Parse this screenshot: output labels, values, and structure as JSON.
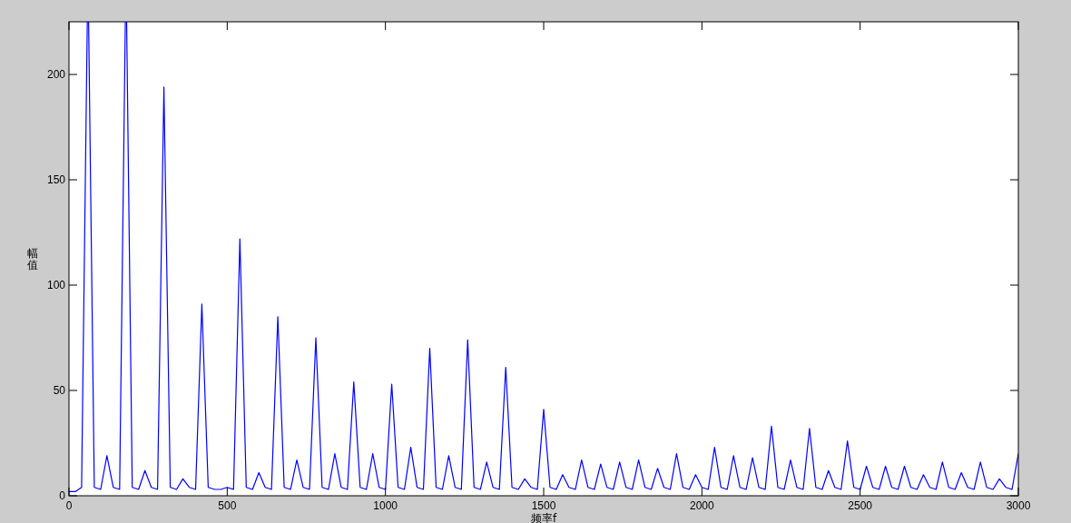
{
  "figure": {
    "chart_data": {
      "type": "line",
      "xlabel": "频率f",
      "ylabel": "幅值",
      "xlim": [
        0,
        3000
      ],
      "ylim": [
        0,
        225
      ],
      "xticks": [
        0,
        500,
        1000,
        1500,
        2000,
        2500,
        3000
      ],
      "yticks": [
        0,
        50,
        100,
        150,
        200
      ],
      "x": [
        0,
        20,
        40,
        60,
        80,
        100,
        120,
        140,
        160,
        180,
        200,
        220,
        240,
        260,
        280,
        300,
        320,
        340,
        360,
        380,
        400,
        420,
        440,
        460,
        480,
        500,
        520,
        540,
        560,
        580,
        600,
        620,
        640,
        660,
        680,
        700,
        720,
        740,
        760,
        780,
        800,
        820,
        840,
        860,
        880,
        900,
        920,
        940,
        960,
        980,
        1000,
        1020,
        1040,
        1060,
        1080,
        1100,
        1120,
        1140,
        1160,
        1180,
        1200,
        1220,
        1240,
        1260,
        1280,
        1300,
        1320,
        1340,
        1360,
        1380,
        1400,
        1420,
        1440,
        1460,
        1480,
        1500,
        1520,
        1540,
        1560,
        1580,
        1600,
        1620,
        1640,
        1660,
        1680,
        1700,
        1720,
        1740,
        1760,
        1780,
        1800,
        1820,
        1840,
        1860,
        1880,
        1900,
        1920,
        1940,
        1960,
        1980,
        2000,
        2020,
        2040,
        2060,
        2080,
        2100,
        2120,
        2140,
        2160,
        2180,
        2200,
        2220,
        2240,
        2260,
        2280,
        2300,
        2320,
        2340,
        2360,
        2380,
        2400,
        2420,
        2440,
        2460,
        2480,
        2500,
        2520,
        2540,
        2560,
        2580,
        2600,
        2620,
        2640,
        2660,
        2680,
        2700,
        2720,
        2740,
        2760,
        2780,
        2800,
        2820,
        2840,
        2860,
        2880,
        2900,
        2920,
        2940,
        2960,
        2980,
        3000
      ],
      "series": [
        {
          "color": "#0000ff",
          "values": [
            2,
            2,
            4,
            null,
            4,
            3,
            19,
            4,
            3,
            null,
            4,
            3,
            12,
            4,
            3,
            194,
            4,
            3,
            8,
            4,
            3,
            91,
            4,
            3,
            3,
            4,
            3,
            122,
            4,
            3,
            11,
            4,
            3,
            85,
            4,
            3,
            17,
            4,
            3,
            75,
            4,
            3,
            20,
            4,
            3,
            54,
            4,
            3,
            20,
            4,
            3,
            53,
            4,
            3,
            23,
            4,
            3,
            70,
            4,
            3,
            19,
            4,
            3,
            74,
            4,
            3,
            16,
            4,
            3,
            61,
            4,
            3,
            8,
            4,
            3,
            41,
            4,
            3,
            10,
            4,
            3,
            17,
            4,
            3,
            15,
            4,
            3,
            16,
            4,
            3,
            17,
            4,
            3,
            13,
            4,
            3,
            20,
            4,
            3,
            10,
            4,
            3,
            23,
            4,
            3,
            19,
            4,
            3,
            18,
            4,
            3,
            33,
            4,
            3,
            17,
            4,
            3,
            32,
            4,
            3,
            12,
            4,
            3,
            26,
            4,
            3,
            14,
            4,
            3,
            14,
            4,
            3,
            14,
            4,
            3,
            10,
            4,
            3,
            16,
            4,
            3,
            11,
            4,
            3,
            16,
            4,
            3,
            8,
            4,
            3,
            20
          ]
        }
      ]
    }
  }
}
